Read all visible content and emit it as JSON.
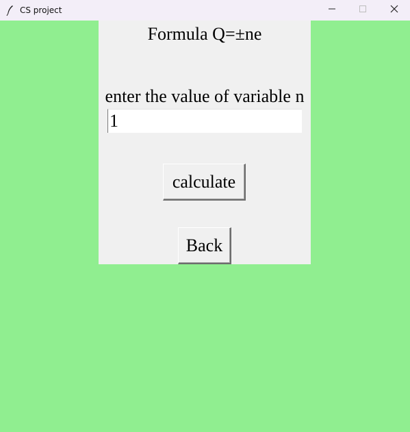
{
  "window": {
    "title": "CS project",
    "app_icon": "feather-icon",
    "controls": {
      "minimize_icon": "minimize-icon",
      "maximize_icon": "maximize-icon",
      "close_icon": "close-icon"
    }
  },
  "colors": {
    "background": "#90ee90",
    "panel": "#f0f0f0",
    "titlebar": "#f3eef8"
  },
  "main": {
    "formula_label": "Formula Q=±ne",
    "prompt_label": "enter the value of variable n",
    "value_input": {
      "value": "1",
      "placeholder": ""
    },
    "calculate_label": "calculate",
    "back_label": "Back"
  }
}
